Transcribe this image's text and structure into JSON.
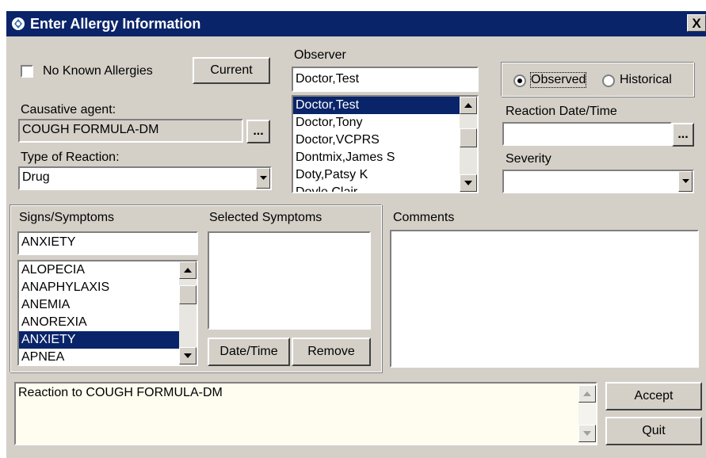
{
  "window": {
    "title": "Enter Allergy Information",
    "close_label": "X"
  },
  "no_known_allergies": {
    "label": "No Known Allergies",
    "checked": false
  },
  "current_button": "Current",
  "causative_agent": {
    "label": "Causative agent:",
    "value": "COUGH FORMULA-DM",
    "browse_label": "..."
  },
  "type_of_reaction": {
    "label": "Type of Reaction:",
    "value": "Drug"
  },
  "observer": {
    "label": "Observer",
    "value": "Doctor,Test",
    "items": [
      "Doctor,Test",
      "Doctor,Tony",
      "Doctor,VCPRS",
      "Dontmix,James S",
      "Doty,Patsy K",
      "Doyle,Clair"
    ],
    "selected_index": 0
  },
  "observation_type": {
    "observed_label": "Observed",
    "historical_label": "Historical",
    "selected": "Observed"
  },
  "reaction_datetime": {
    "label": "Reaction Date/Time",
    "value": "",
    "browse_label": "..."
  },
  "severity": {
    "label": "Severity",
    "value": ""
  },
  "signs_symptoms": {
    "label": "Signs/Symptoms",
    "search_value": "ANXIETY",
    "items": [
      "ALOPECIA",
      "ANAPHYLAXIS",
      "ANEMIA",
      "ANOREXIA",
      "ANXIETY",
      "APNEA"
    ],
    "selected_index": 4
  },
  "selected_symptoms": {
    "label": "Selected Symptoms",
    "items": [],
    "datetime_button": "Date/Time",
    "remove_button": "Remove"
  },
  "comments": {
    "label": "Comments",
    "value": ""
  },
  "summary": {
    "text": "Reaction to COUGH FORMULA-DM"
  },
  "accept_button": "Accept",
  "quit_button": "Quit",
  "icons": {
    "title": "app-icon",
    "dropdown": "chevron-down-icon",
    "scroll_up": "arrow-up-icon",
    "scroll_down": "arrow-down-icon"
  },
  "colors": {
    "title_bar": "#0a246a",
    "face": "#d4d0c8",
    "selection": "#0a246a",
    "summary_background": "#fffdf0"
  }
}
